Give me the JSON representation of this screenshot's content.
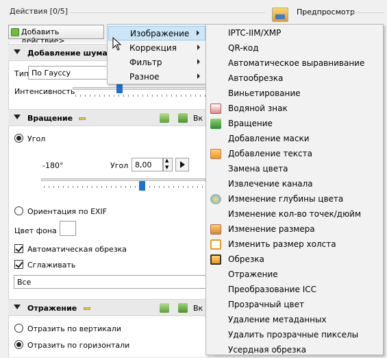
{
  "actions_group": {
    "title": "Действия [0/5]"
  },
  "preview": {
    "label": "Предпросмотр",
    "icon": "preview-icon"
  },
  "add_action_button": {
    "label": "Добавить действие>"
  },
  "noise_section": {
    "title": "Добавление шума",
    "type_label": "Тип",
    "type_value": "По Гауссу",
    "intensity_label": "Интенсивность"
  },
  "rotation_section": {
    "title": "Вращение",
    "apply_label": "Вк",
    "angle_radio": "Угол",
    "min_label": "-180°",
    "angle_field_label": "Угол",
    "angle_value": "8,00",
    "exif_radio": "Ориентация по EXIF",
    "bg_color_label": "Цвет фона",
    "auto_crop_label": "Автоматическая обрезка",
    "smooth_label": "Сглаживать",
    "select_value": "Все"
  },
  "mirror_section": {
    "title": "Отражение",
    "apply_label": "Вк",
    "vertical_label": "Отразить по вертикали",
    "horizontal_label": "Отразить по горизонтали"
  },
  "context_menu": {
    "items": [
      {
        "label": "Изображение",
        "highlighted": true
      },
      {
        "label": "Коррекция"
      },
      {
        "label": "Фильтр"
      },
      {
        "label": "Разное"
      }
    ]
  },
  "submenu": {
    "items": [
      {
        "label": "IPTC-IIM/XMP",
        "icon": ""
      },
      {
        "label": "QR-код",
        "icon": ""
      },
      {
        "label": "Автоматическое выравнивание",
        "icon": ""
      },
      {
        "label": "Автообрезка",
        "icon": ""
      },
      {
        "label": "Виньетирование",
        "icon": ""
      },
      {
        "label": "Водяной знак",
        "icon": "watermark-icon"
      },
      {
        "label": "Вращение",
        "icon": "rotate-icon"
      },
      {
        "label": "Добавление маски",
        "icon": ""
      },
      {
        "label": "Добавление текста",
        "icon": "add-text-icon"
      },
      {
        "label": "Замена цвета",
        "icon": ""
      },
      {
        "label": "Извлечение канала",
        "icon": ""
      },
      {
        "label": "Изменение глубины цвета",
        "icon": "color-depth-icon"
      },
      {
        "label": "Изменение кол-во точек/дюйм",
        "icon": ""
      },
      {
        "label": "Изменение размера",
        "icon": "resize-icon"
      },
      {
        "label": "Изменить размер холста",
        "icon": "canvas-size-icon"
      },
      {
        "label": "Обрезка",
        "icon": "crop-icon"
      },
      {
        "label": "Отражение",
        "icon": ""
      },
      {
        "label": "Преобразование ICC",
        "icon": ""
      },
      {
        "label": "Прозрачный цвет",
        "icon": ""
      },
      {
        "label": "Удаление метаданных",
        "icon": ""
      },
      {
        "label": "Удалить прозрачные пикселы",
        "icon": ""
      },
      {
        "label": "Усердная обрезка",
        "icon": ""
      }
    ]
  },
  "colors": {
    "accent": "#1874d2",
    "menu_highlight": "#cde6f7"
  }
}
